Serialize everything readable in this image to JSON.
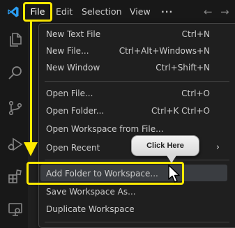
{
  "menubar": {
    "items": [
      {
        "label": "File"
      },
      {
        "label": "Edit"
      },
      {
        "label": "Selection"
      },
      {
        "label": "View"
      },
      {
        "label": "···"
      }
    ],
    "back_arrow": "←",
    "forward_arrow": "→"
  },
  "activitybar": {
    "icons": [
      "files-icon",
      "search-icon",
      "source-control-icon",
      "run-debug-icon",
      "extensions-icon",
      "remote-explorer-icon"
    ]
  },
  "file_menu": {
    "groups": [
      [
        {
          "label": "New Text File",
          "shortcut": "Ctrl+N"
        },
        {
          "label": "New File...",
          "shortcut": "Ctrl+Alt+Windows+N"
        },
        {
          "label": "New Window",
          "shortcut": "Ctrl+Shift+N"
        }
      ],
      [
        {
          "label": "Open File...",
          "shortcut": "Ctrl+O"
        },
        {
          "label": "Open Folder...",
          "shortcut": "Ctrl+K Ctrl+O"
        },
        {
          "label": "Open Workspace from File...",
          "shortcut": ""
        },
        {
          "label": "Open Recent",
          "shortcut": "",
          "submenu": true
        }
      ],
      [
        {
          "label": "Add Folder to Workspace...",
          "shortcut": "",
          "highlighted": true
        },
        {
          "label": "Save Workspace As...",
          "shortcut": ""
        },
        {
          "label": "Duplicate Workspace",
          "shortcut": ""
        }
      ]
    ],
    "submenu_chevron": "›"
  },
  "annotation": {
    "callout_text": "Click Here",
    "highlight_color": "#ffea00"
  },
  "theme": {
    "background": "#1f1f1f",
    "menu_text": "#cccccc",
    "vscode_blue": "#2b9ef3"
  }
}
